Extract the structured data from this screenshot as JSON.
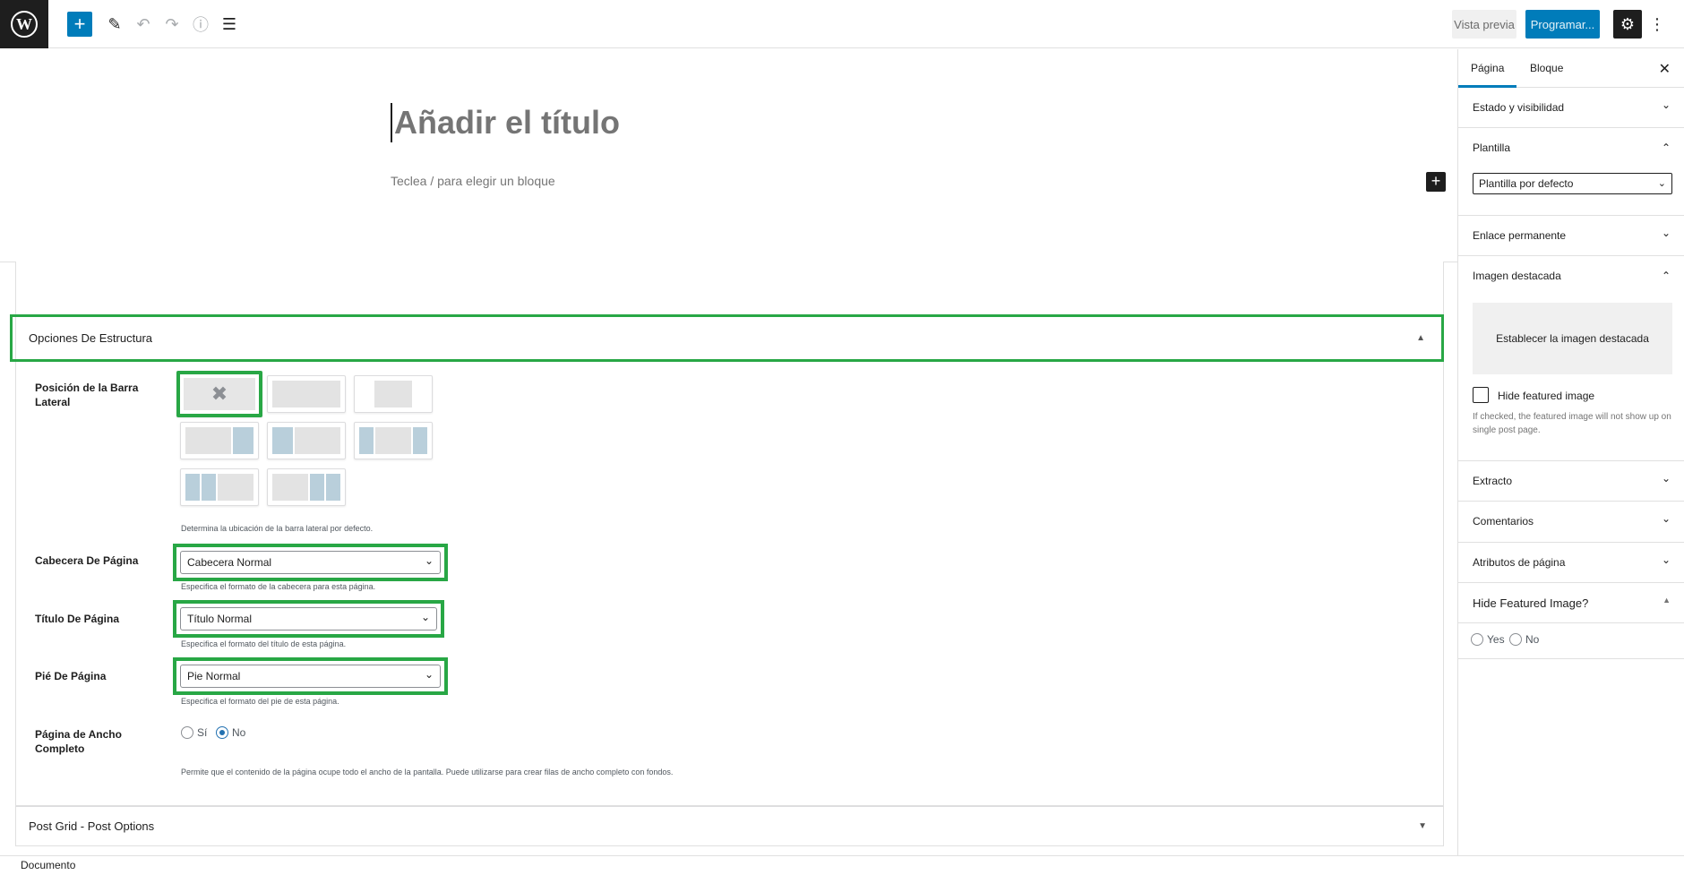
{
  "toolbar": {
    "wp_logo": "W",
    "add_icon": "+",
    "edit_icon": "✎",
    "undo_icon": "↶",
    "redo_icon": "↷",
    "info_icon": "ⓘ",
    "list_icon": "☰",
    "preview_label": "Vista previa",
    "schedule_label": "Programar...",
    "settings_icon": "⚙",
    "more_icon": "⋮"
  },
  "editor": {
    "title_placeholder": "Añadir el título",
    "block_placeholder": "Teclea / para elegir un bloque",
    "inline_add_icon": "+"
  },
  "structure_box": {
    "title": "Opciones De Estructura",
    "toggle_icon": "▲",
    "sidebar_position_label": "Posición de la Barra Lateral",
    "sidebar_position_help": "Determina la ubicación de la barra lateral por defecto.",
    "no_sidebar_icon": "✖",
    "header_label": "Cabecera De Página",
    "header_value": "Cabecera Normal",
    "header_help": "Especifica el formato de la cabecera para esta página.",
    "title_label": "Título De Página",
    "title_value": "Título Normal",
    "title_help": "Especifica el formato del título de esta página.",
    "footer_label": "Pié De Página",
    "footer_value": "Pie Normal",
    "footer_help": "Especifica el formato del pie de esta página.",
    "fullwidth_label": "Página de Ancho Completo",
    "fullwidth_yes": "Sí",
    "fullwidth_no": "No",
    "fullwidth_help": "Permite que el contenido de la página ocupe todo el ancho de la pantalla. Puede utilizarse para crear filas de ancho completo con fondos.",
    "chevron_icon": "⌄"
  },
  "post_grid_box": {
    "title": "Post Grid - Post Options",
    "toggle_icon": "▼"
  },
  "footer": {
    "breadcrumb": "Documento"
  },
  "sidebar": {
    "tab_page": "Página",
    "tab_block": "Bloque",
    "close_icon": "✕",
    "status_visibility": "Estado y visibilidad",
    "template": "Plantilla",
    "template_value": "Plantilla por defecto",
    "permalink": "Enlace permanente",
    "featured_image": "Imagen destacada",
    "set_featured_image": "Establecer la imagen destacada",
    "hide_featured_label": "Hide featured image",
    "hide_featured_help": "If checked, the featured image will not show up on single post page.",
    "excerpt": "Extracto",
    "comments": "Comentarios",
    "page_attributes": "Atributos de página",
    "hide_featured_q": "Hide Featured Image?",
    "yes": "Yes",
    "no": "No",
    "chevron_down": "⌄",
    "chevron_up": "⌃",
    "triangle_up": "▲"
  }
}
